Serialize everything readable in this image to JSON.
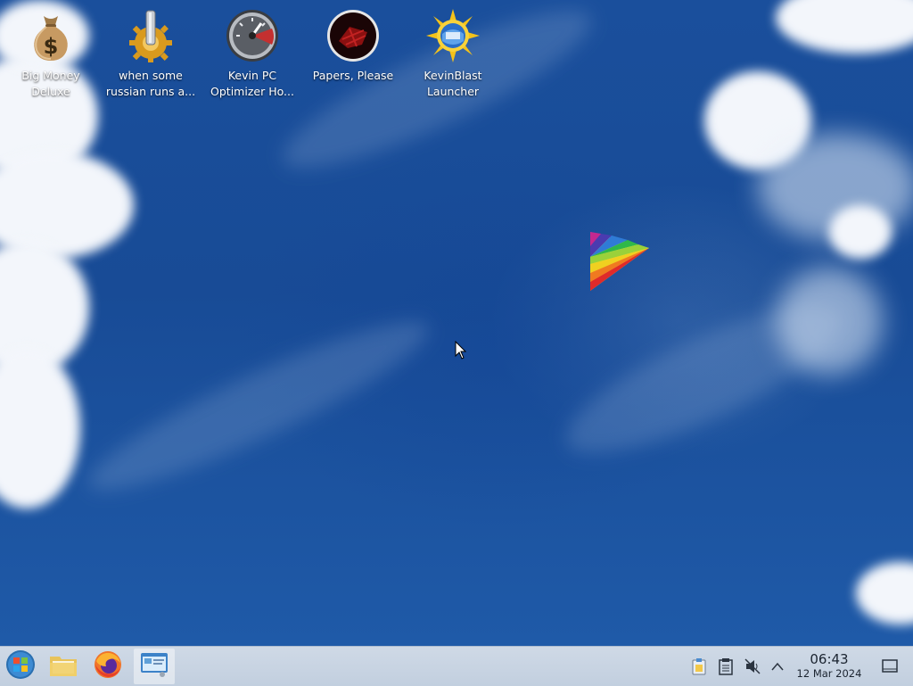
{
  "desktop": {
    "icons": [
      {
        "line1": "Big Money",
        "line2": "Deluxe",
        "icon": "money-bag-icon"
      },
      {
        "line1": "when some",
        "line2": "russian runs a...",
        "icon": "gear-lever-icon"
      },
      {
        "line1": "Kevin PC",
        "line2": "Optimizer Ho...",
        "icon": "speedometer-icon"
      },
      {
        "line1": "Papers, Please",
        "line2": "",
        "icon": "papers-please-icon"
      },
      {
        "line1": "KevinBlast",
        "line2": "Launcher",
        "icon": "sun-globe-icon"
      }
    ]
  },
  "taskbar": {
    "pinned": [
      {
        "name": "start-menu-button",
        "icon": "windows-orb-icon"
      },
      {
        "name": "file-manager-button",
        "icon": "folder-icon"
      },
      {
        "name": "firefox-button",
        "icon": "firefox-icon"
      },
      {
        "name": "active-window-button",
        "icon": "window-preview-icon"
      }
    ],
    "tray": [
      "clipboard-icon",
      "notes-icon",
      "volume-muted-icon",
      "chevron-up-icon",
      "show-desktop-icon"
    ],
    "clock": {
      "time": "06:43",
      "date": "12 Mar 2024"
    }
  }
}
